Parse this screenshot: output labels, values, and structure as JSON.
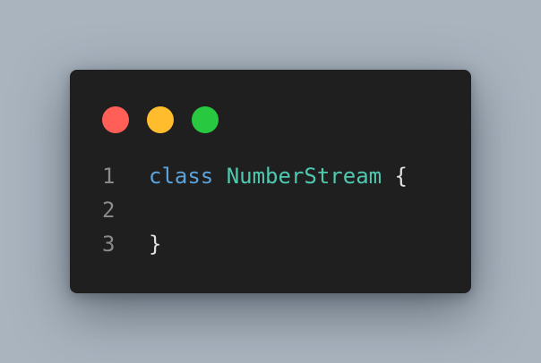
{
  "colors": {
    "background": "#a9b4bf",
    "window": "#1f1f1f",
    "dot_close": "#ff5f57",
    "dot_minimize": "#ffbd2e",
    "dot_maximize": "#28c940",
    "line_number": "#8a8a8a",
    "keyword": "#5ba3dc",
    "class_name": "#4ec9b0",
    "punctuation": "#e0e0e0"
  },
  "window_controls": [
    {
      "name": "close-dot",
      "color": "#ff5f57"
    },
    {
      "name": "minimize-dot",
      "color": "#ffbd2e"
    },
    {
      "name": "maximize-dot",
      "color": "#28c940"
    }
  ],
  "code": {
    "lines": [
      {
        "number": "1",
        "keyword": "class",
        "class_name": "NumberStream",
        "punct": "{"
      },
      {
        "number": "2",
        "keyword": "",
        "class_name": "",
        "punct": ""
      },
      {
        "number": "3",
        "keyword": "",
        "class_name": "",
        "punct": "}"
      }
    ]
  }
}
